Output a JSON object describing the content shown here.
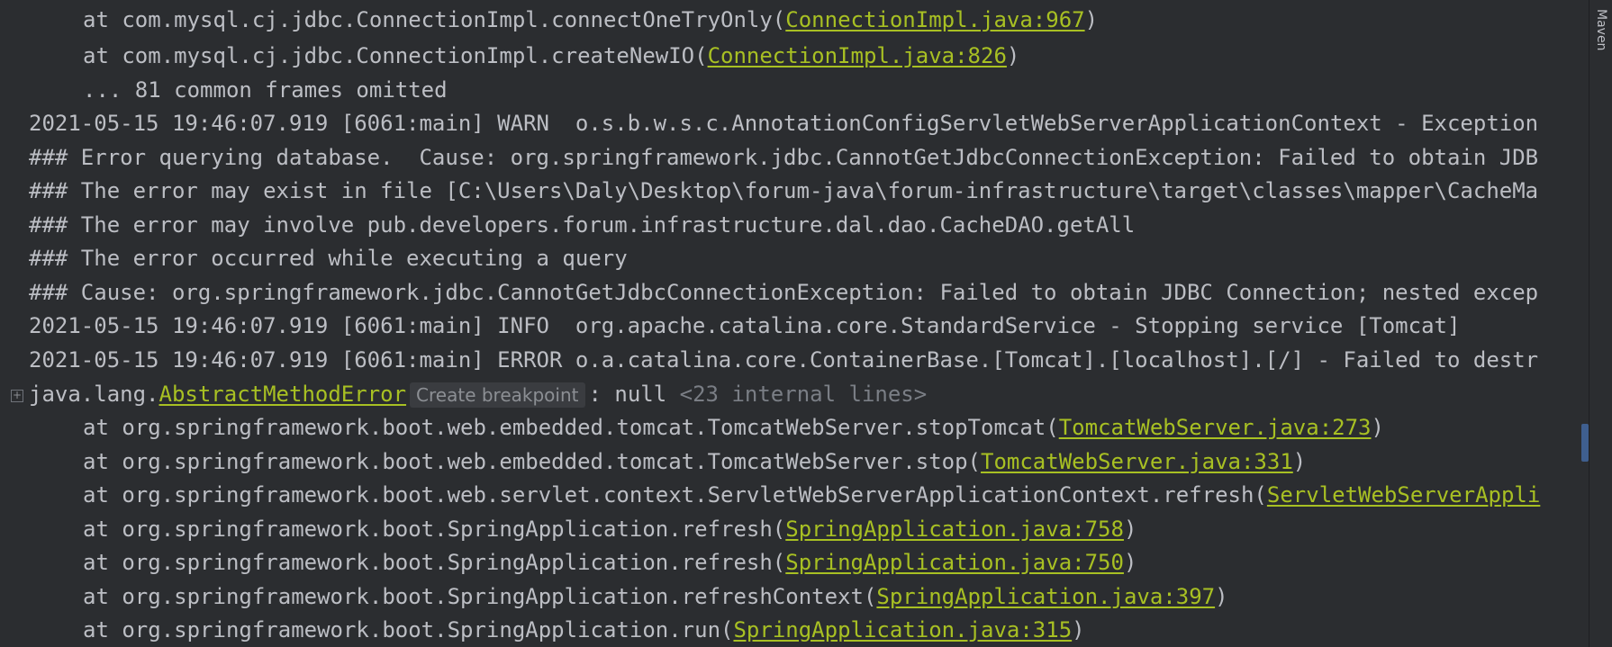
{
  "side_panel": {
    "label": "Maven"
  },
  "console": {
    "hint_label": "Create breakpoint",
    "lines": [
      {
        "prefix": "at com.mysql.cj.jdbc.ConnectionImpl.connectOneTryOnly(",
        "link": "ConnectionImpl.java:967",
        "suffix": ")"
      },
      {
        "prefix": "at com.mysql.cj.jdbc.ConnectionImpl.createNewIO(",
        "link": "ConnectionImpl.java:826",
        "suffix": ")"
      },
      {
        "text": "... 81 common frames omitted"
      },
      {
        "text": "2021-05-15 19:46:07.919 [6061:main] WARN  o.s.b.w.s.c.AnnotationConfigServletWebServerApplicationContext - Exception"
      },
      {
        "text": "### Error querying database.  Cause: org.springframework.jdbc.CannotGetJdbcConnectionException: Failed to obtain JDB"
      },
      {
        "text": "### The error may exist in file [C:\\Users\\Daly\\Desktop\\forum-java\\forum-infrastructure\\target\\classes\\mapper\\CacheMa"
      },
      {
        "text": "### The error may involve pub.developers.forum.infrastructure.dal.dao.CacheDAO.getAll"
      },
      {
        "text": "### The error occurred while executing a query"
      },
      {
        "text": "### Cause: org.springframework.jdbc.CannotGetJdbcConnectionException: Failed to obtain JDBC Connection; nested excep"
      },
      {
        "text": "2021-05-15 19:46:07.919 [6061:main] INFO  org.apache.catalina.core.StandardService - Stopping service [Tomcat]"
      },
      {
        "text": "2021-05-15 19:46:07.919 [6061:main] ERROR o.a.catalina.core.ContainerBase.[Tomcat].[localhost].[/] - Failed to destr"
      },
      {
        "prefix": "java.lang.",
        "link": "AbstractMethodError",
        "after_hint": ": null ",
        "folded": "<23 internal lines>"
      },
      {
        "prefix": "at org.springframework.boot.web.embedded.tomcat.TomcatWebServer.stopTomcat(",
        "link": "TomcatWebServer.java:273",
        "suffix": ")"
      },
      {
        "prefix": "at org.springframework.boot.web.embedded.tomcat.TomcatWebServer.stop(",
        "link": "TomcatWebServer.java:331",
        "suffix": ")"
      },
      {
        "prefix": "at org.springframework.boot.web.servlet.context.ServletWebServerApplicationContext.refresh(",
        "link": "ServletWebServerAppli",
        "suffix": ""
      },
      {
        "prefix": "at org.springframework.boot.SpringApplication.refresh(",
        "link": "SpringApplication.java:758",
        "suffix": ")"
      },
      {
        "prefix": "at org.springframework.boot.SpringApplication.refresh(",
        "link": "SpringApplication.java:750",
        "suffix": ")"
      },
      {
        "prefix": "at org.springframework.boot.SpringApplication.refreshContext(",
        "link": "SpringApplication.java:397",
        "suffix": ")"
      },
      {
        "prefix": "at org.springframework.boot.SpringApplication.run(",
        "link": "SpringApplication.java:315",
        "suffix": ")"
      }
    ]
  },
  "colors": {
    "background": "#2b2d30",
    "text": "#bcbec4",
    "link": "#a8c023",
    "folded": "#7a7e85",
    "scroll_marker": "#3f5f8f"
  }
}
